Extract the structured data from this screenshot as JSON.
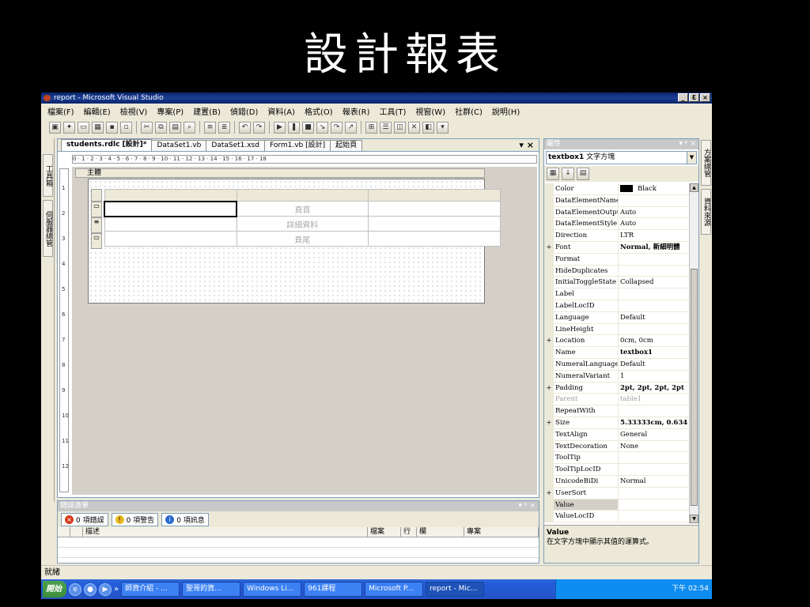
{
  "slide": {
    "title": "設計報表"
  },
  "window": {
    "title": "report - Microsoft Visual Studio",
    "controls": [
      "_",
      "Ɛ",
      "×"
    ]
  },
  "menu": [
    "檔案(F)",
    "編輯(E)",
    "檢視(V)",
    "專案(P)",
    "建置(B)",
    "偵錯(D)",
    "資料(A)",
    "格式(O)",
    "報表(R)",
    "工具(T)",
    "視窗(W)",
    "社群(C)",
    "說明(H)"
  ],
  "toolbar_icons": [
    "new-project-icon",
    "add-item-icon",
    "open-icon",
    "add-icon",
    "save-icon",
    "save-all-icon",
    "cut-icon",
    "copy-icon",
    "paste-icon",
    "find-icon",
    "outdent-icon",
    "indent-icon",
    "undo-icon",
    "redo-icon",
    "start-icon",
    "pause-icon",
    "stop-icon",
    "step-into-icon",
    "step-over-icon",
    "step-out-icon",
    "solution-explorer-icon",
    "properties-icon",
    "object-browser-icon",
    "toolbox-icon",
    "start-page-icon",
    "more-icon"
  ],
  "left_tabs": [
    "工具箱",
    "伺服器總管"
  ],
  "right_tabs": [
    "方案總管",
    "資料來源"
  ],
  "doc_tabs": [
    {
      "label": "students.rdlc [設計]*",
      "active": true
    },
    {
      "label": "DataSet1.vb",
      "active": false
    },
    {
      "label": "DataSet1.xsd",
      "active": false
    },
    {
      "label": "Form1.vb [設計]",
      "active": false
    },
    {
      "label": "起始頁",
      "active": false
    }
  ],
  "doc_tools": "▾ ×",
  "ruler_h": "0 · 1 · 2 · 3 · 4 · 5 · 6 · 7 · 8 · 9 · 10 · 11 · 12 · 13 · 14 · 15 · 16 · 17 · 18",
  "ruler_v": [
    "1",
    "2",
    "3",
    "4",
    "5",
    "6",
    "7",
    "8",
    "9",
    "10",
    "11",
    "12"
  ],
  "body_label": "主體",
  "table": {
    "rows": [
      {
        "type": "header",
        "cells": [
          "",
          "",
          ""
        ]
      },
      {
        "type": "table-header",
        "cells": [
          "",
          "頁首",
          ""
        ]
      },
      {
        "type": "details",
        "cells": [
          "",
          "詳細資料",
          ""
        ]
      },
      {
        "type": "footer",
        "cells": [
          "",
          "頁尾",
          ""
        ]
      }
    ]
  },
  "error_list": {
    "title": "錯誤清單",
    "controls": "▾ ᵖ ×",
    "buttons": [
      {
        "label": "0 項錯誤",
        "color": "#d43b1a",
        "glyph": "×"
      },
      {
        "label": "0 項警告",
        "color": "#e8b820",
        "glyph": "!"
      },
      {
        "label": "0 項訊息",
        "color": "#2a6ad0",
        "glyph": "i"
      }
    ],
    "columns": [
      "",
      "",
      "描述",
      "檔案",
      "行",
      "欄",
      "專案"
    ]
  },
  "status": "就緒",
  "properties": {
    "title": "屬性",
    "controls": "▾ ᵖ ×",
    "object_name": "textbox1",
    "object_type": "文字方塊",
    "rows": [
      {
        "exp": "",
        "name": "Color",
        "value": "Black",
        "swatch": true
      },
      {
        "exp": "",
        "name": "DataElementName",
        "value": ""
      },
      {
        "exp": "",
        "name": "DataElementOutput",
        "value": "Auto"
      },
      {
        "exp": "",
        "name": "DataElementStyle",
        "value": "Auto"
      },
      {
        "exp": "",
        "name": "Direction",
        "value": "LTR"
      },
      {
        "exp": "+",
        "name": "Font",
        "value": "Normal, 新細明體",
        "bold": true
      },
      {
        "exp": "",
        "name": "Format",
        "value": ""
      },
      {
        "exp": "",
        "name": "HideDuplicates",
        "value": ""
      },
      {
        "exp": "",
        "name": "InitialToggleState",
        "value": "Collapsed"
      },
      {
        "exp": "",
        "name": "Label",
        "value": ""
      },
      {
        "exp": "",
        "name": "LabelLocID",
        "value": ""
      },
      {
        "exp": "",
        "name": "Language",
        "value": "Default"
      },
      {
        "exp": "",
        "name": "LineHeight",
        "value": ""
      },
      {
        "exp": "+",
        "name": "Location",
        "value": "0cm, 0cm"
      },
      {
        "exp": "",
        "name": "Name",
        "value": "textbox1",
        "bold": true
      },
      {
        "exp": "",
        "name": "NumeralLanguage",
        "value": "Default"
      },
      {
        "exp": "",
        "name": "NumeralVariant",
        "value": "1"
      },
      {
        "exp": "+",
        "name": "Padding",
        "value": "2pt, 2pt, 2pt, 2pt",
        "bold": true
      },
      {
        "exp": "",
        "name": "Parent",
        "value": "table1",
        "dim": true
      },
      {
        "exp": "",
        "name": "RepeatWith",
        "value": ""
      },
      {
        "exp": "+",
        "name": "Size",
        "value": "5.33333cm, 0.634",
        "bold": true
      },
      {
        "exp": "",
        "name": "TextAlign",
        "value": "General"
      },
      {
        "exp": "",
        "name": "TextDecoration",
        "value": "None"
      },
      {
        "exp": "",
        "name": "ToolTip",
        "value": ""
      },
      {
        "exp": "",
        "name": "ToolTipLocID",
        "value": ""
      },
      {
        "exp": "",
        "name": "UnicodeBiDi",
        "value": "Normal"
      },
      {
        "exp": "+",
        "name": "UserSort",
        "value": ""
      },
      {
        "exp": "",
        "name": "Value",
        "value": "",
        "selected": true
      },
      {
        "exp": "",
        "name": "ValueLocID",
        "value": ""
      }
    ],
    "desc_title": "Value",
    "desc_text": "在文字方塊中顯示其值的運算式。"
  },
  "taskbar": {
    "start": "開始",
    "quick_launch": [
      "e",
      "●",
      "▶"
    ],
    "more": "»",
    "items": [
      {
        "label": "師資介紹 - ...",
        "active": false
      },
      {
        "label": "聖哥的資...",
        "active": false
      },
      {
        "label": "Windows Li...",
        "active": false
      },
      {
        "label": "961課程",
        "active": false
      },
      {
        "label": "Microsoft P...",
        "active": false
      },
      {
        "label": "report - Mic...",
        "active": true
      }
    ],
    "clock": "下午 02:54"
  }
}
